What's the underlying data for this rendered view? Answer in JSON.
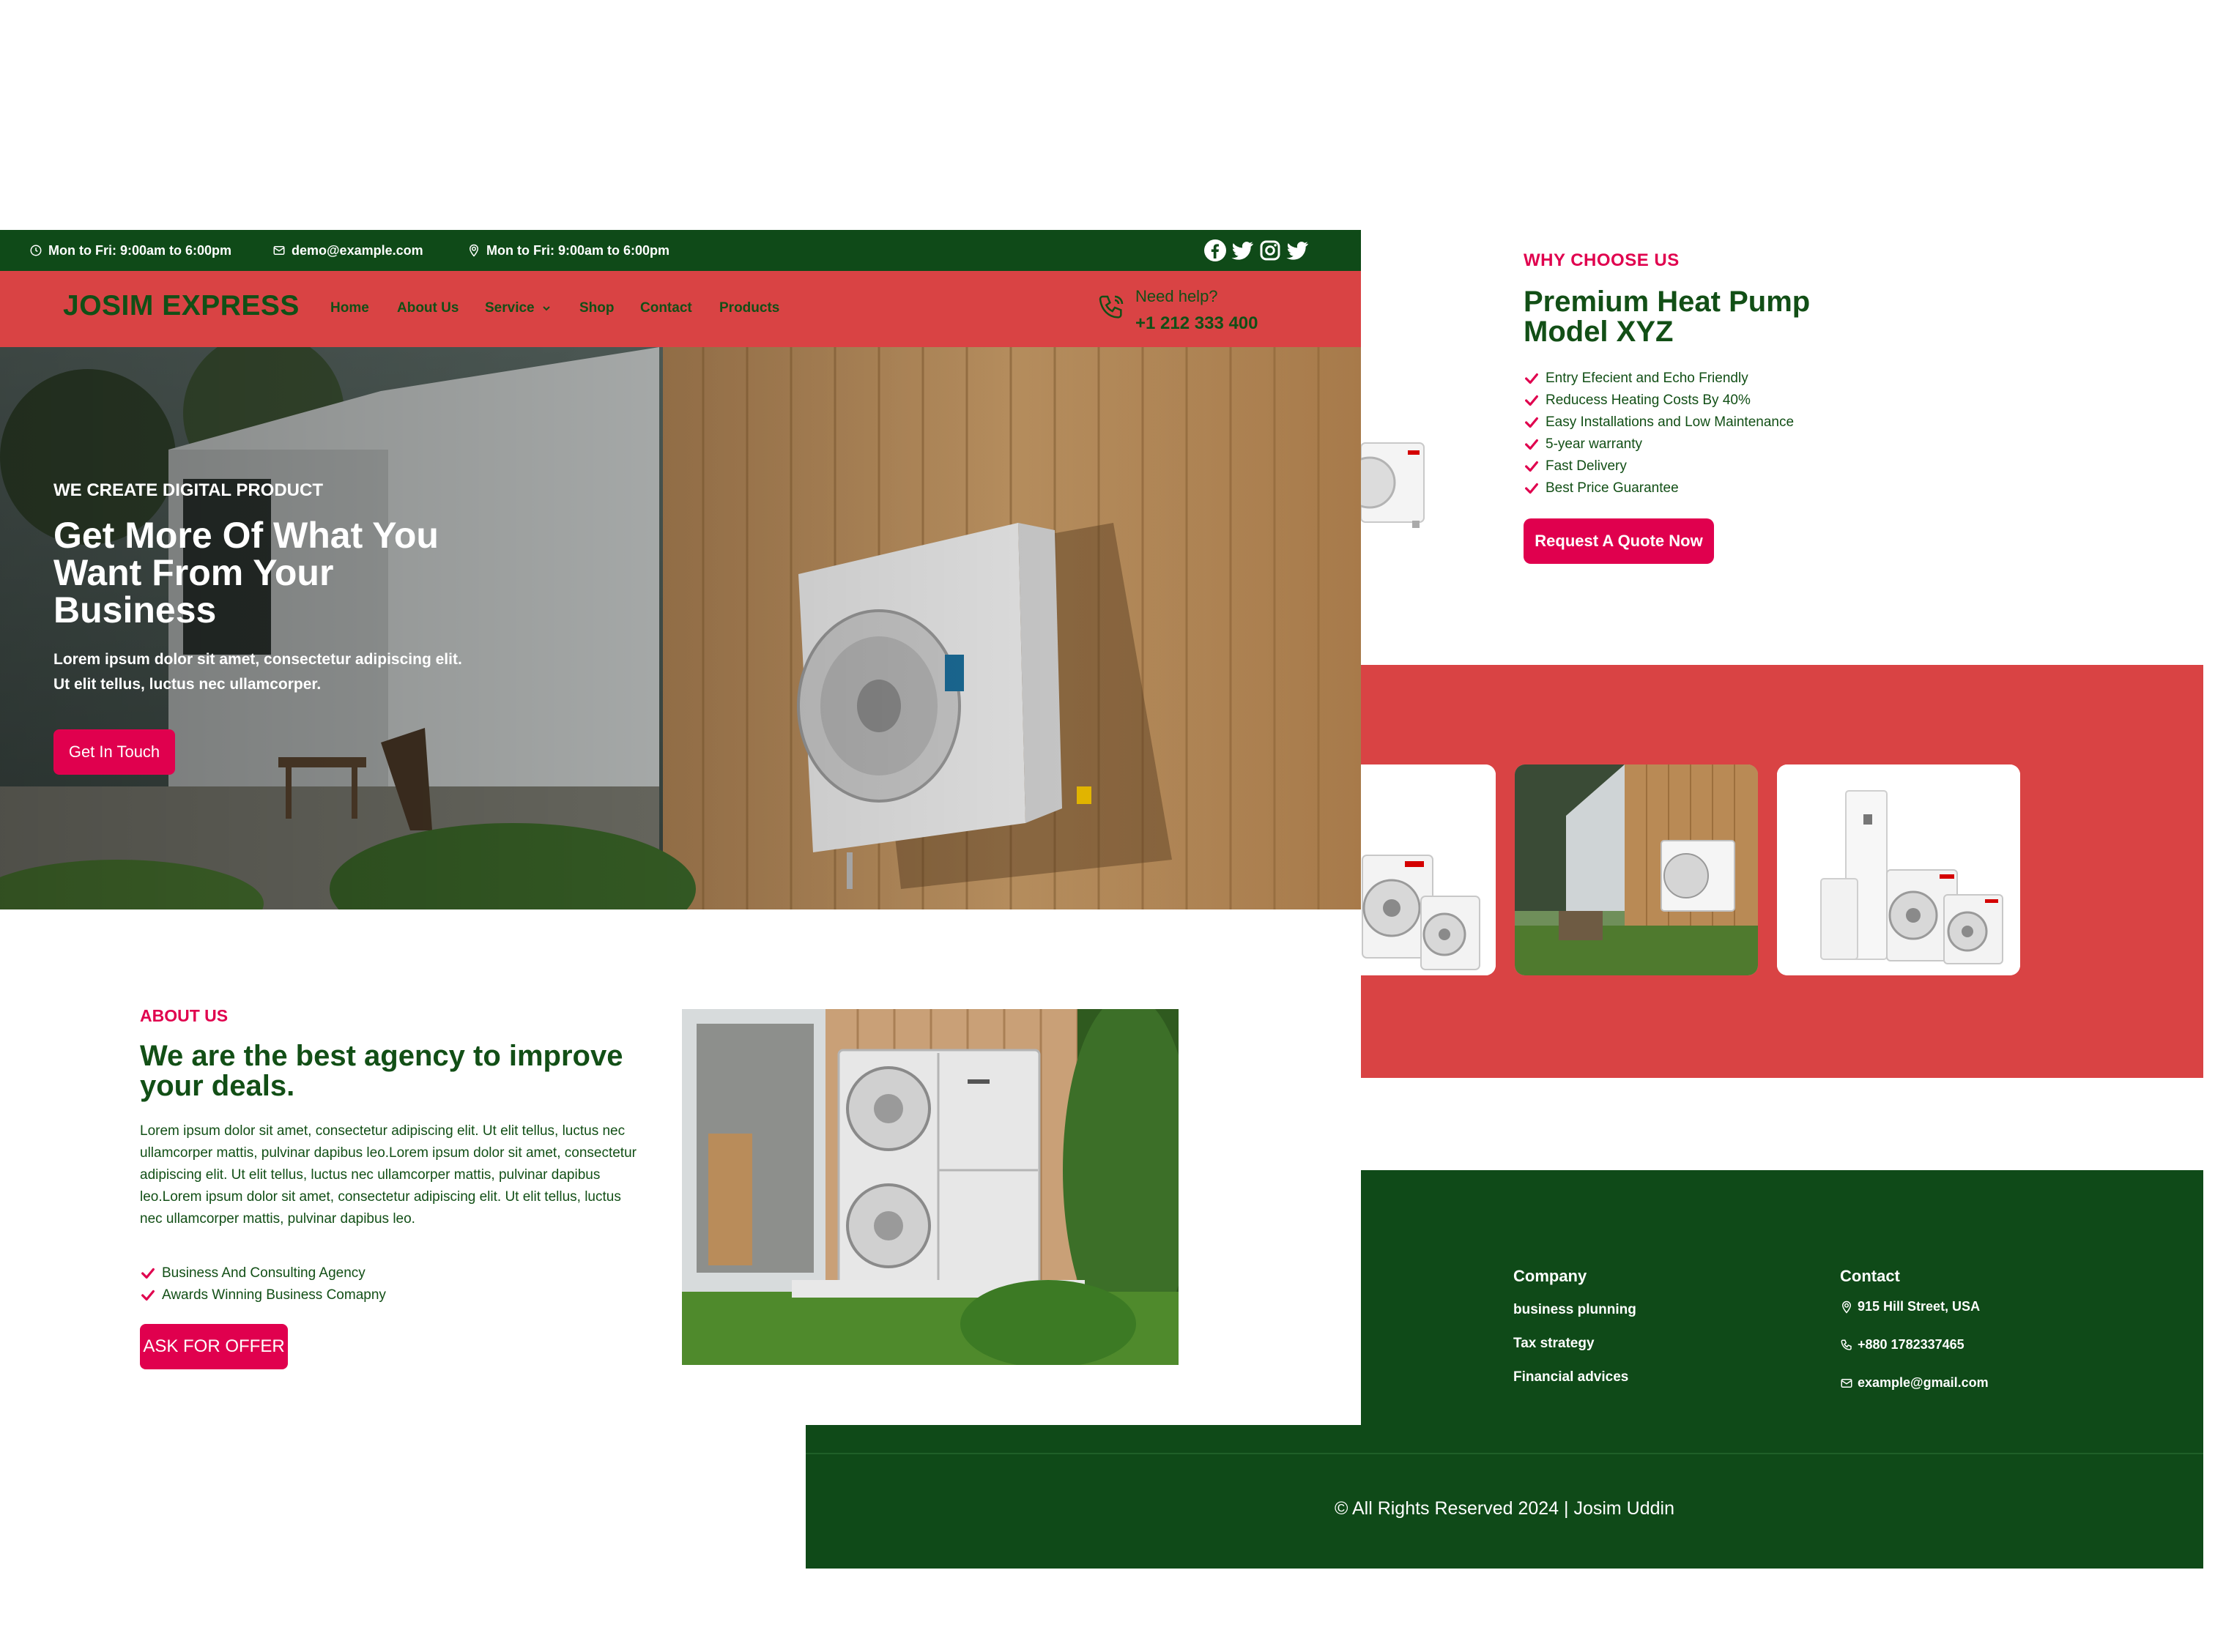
{
  "topbar": {
    "hours": "Mon to Fri: 9:00am to 6:00pm",
    "email": "demo@example.com",
    "location_hours": "Mon to Fri: 9:00am to 6:00pm",
    "social_icons": [
      "facebook-icon",
      "twitter-icon",
      "instagram-icon",
      "twitter-icon"
    ]
  },
  "nav": {
    "brand": "JOSIM EXPRESS",
    "items": [
      "Home",
      "About Us",
      "Service",
      "Shop",
      "Contact",
      "Products"
    ],
    "help_label": "Need help?",
    "help_phone": "+1 212 333 400"
  },
  "hero": {
    "eyebrow": "WE CREATE DIGITAL PRODUCT",
    "title": "Get More Of What You Want From Your Business",
    "text": "Lorem ipsum dolor sit amet, consectetur adipiscing elit. Ut elit tellus, luctus nec ullamcorper.",
    "button": "Get In Touch"
  },
  "about": {
    "eyebrow": "ABOUT US",
    "title": "We are the best agency to improve your deals.",
    "text": "Lorem ipsum dolor sit amet, consectetur adipiscing elit. Ut elit tellus, luctus nec ullamcorper mattis, pulvinar dapibus leo.Lorem ipsum dolor sit amet, consectetur adipiscing elit. Ut elit tellus, luctus nec ullamcorper mattis, pulvinar dapibus leo.Lorem ipsum dolor sit amet, consectetur adipiscing elit. Ut elit tellus, luctus nec ullamcorper mattis, pulvinar dapibus leo.",
    "list": [
      "Business And Consulting Agency",
      "Awards Winning Business Comapny"
    ],
    "button": "ASK FOR OFFER"
  },
  "why": {
    "eyebrow": "WHY CHOOSE US",
    "title": "Premium Heat Pump Model XYZ",
    "list": [
      "Entry Efecient and Echo Friendly",
      "Reducess Heating Costs By 40%",
      "Easy Installations and Low Maintenance",
      "5-year warranty",
      "Fast Delivery",
      "Best Price Guarantee"
    ],
    "button": "Request A Quote Now"
  },
  "footer": {
    "company_heading": "Company",
    "company_links": [
      "business plunning",
      "Tax strategy",
      "Financial advices"
    ],
    "contact_heading": "Contact",
    "address": "915 Hill Street, USA",
    "phone": "+880 1782337465",
    "email": "example@gmail.com",
    "copyright": "© All Rights Reserved 2024 | Josim Uddin"
  },
  "colors": {
    "dark_green": "#0f4a18",
    "text_green": "#124f16",
    "nav_red": "#d94344",
    "accent_pink": "#e0004e"
  }
}
